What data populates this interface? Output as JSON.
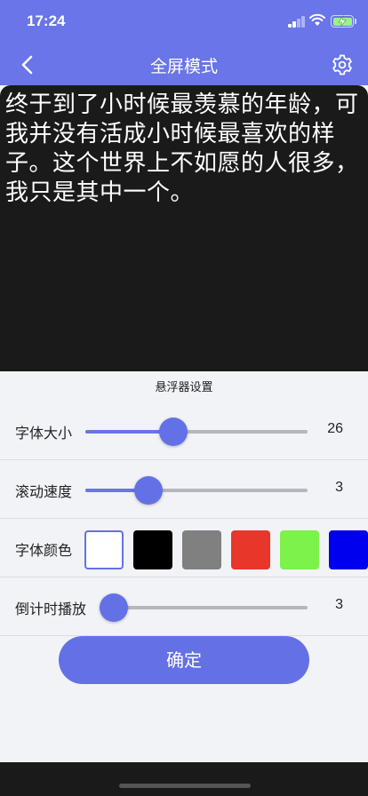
{
  "status": {
    "time": "17:24"
  },
  "nav": {
    "title": "全屏模式",
    "back_icon": "chevron-left-icon",
    "settings_icon": "gear-icon"
  },
  "display": {
    "text": "终于到了小时候最羡慕的年龄，可我并没有活成小时候最喜欢的样子。这个世界上不如愿的人很多，我只是其中一个。",
    "background": "#1a1a1a",
    "text_color": "#ffffff"
  },
  "settings": {
    "title": "悬浮器设置",
    "font_size": {
      "label": "字体大小",
      "value": "26",
      "fraction": 0.38
    },
    "scroll_speed": {
      "label": "滚动速度",
      "value": "3",
      "fraction": 0.25
    },
    "font_color": {
      "label": "字体颜色",
      "options": [
        "#ffffff",
        "#000000",
        "#808080",
        "#e8362a",
        "#7cf24a",
        "#0000ee"
      ],
      "selected": "#ffffff"
    },
    "countdown": {
      "label": "倒计时播放",
      "value": "3",
      "fraction": 0.0
    }
  },
  "confirm_label": "确定",
  "colors": {
    "accent": "#6471e6",
    "header": "#6975e8"
  }
}
